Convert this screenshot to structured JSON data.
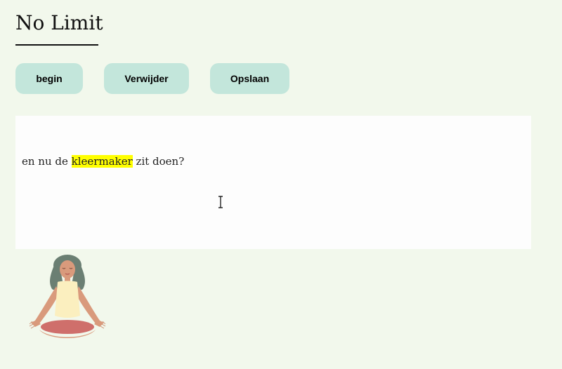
{
  "app": {
    "title": "No Limit"
  },
  "toolbar": {
    "begin_label": "begin",
    "verwijder_label": "Verwijder",
    "opslaan_label": "Opslaan"
  },
  "editor": {
    "text_before": "en nu de ",
    "highlighted_word": "kleermaker",
    "text_after": " zit doen?",
    "highlight_color": "#ffff00"
  },
  "colors": {
    "background": "#f2f8ec",
    "button": "#c3e6db",
    "editor_bg": "#fdfdfd"
  },
  "icons": {
    "cursor": "text-cursor-icon",
    "illustration": "meditating-woman-illustration"
  }
}
